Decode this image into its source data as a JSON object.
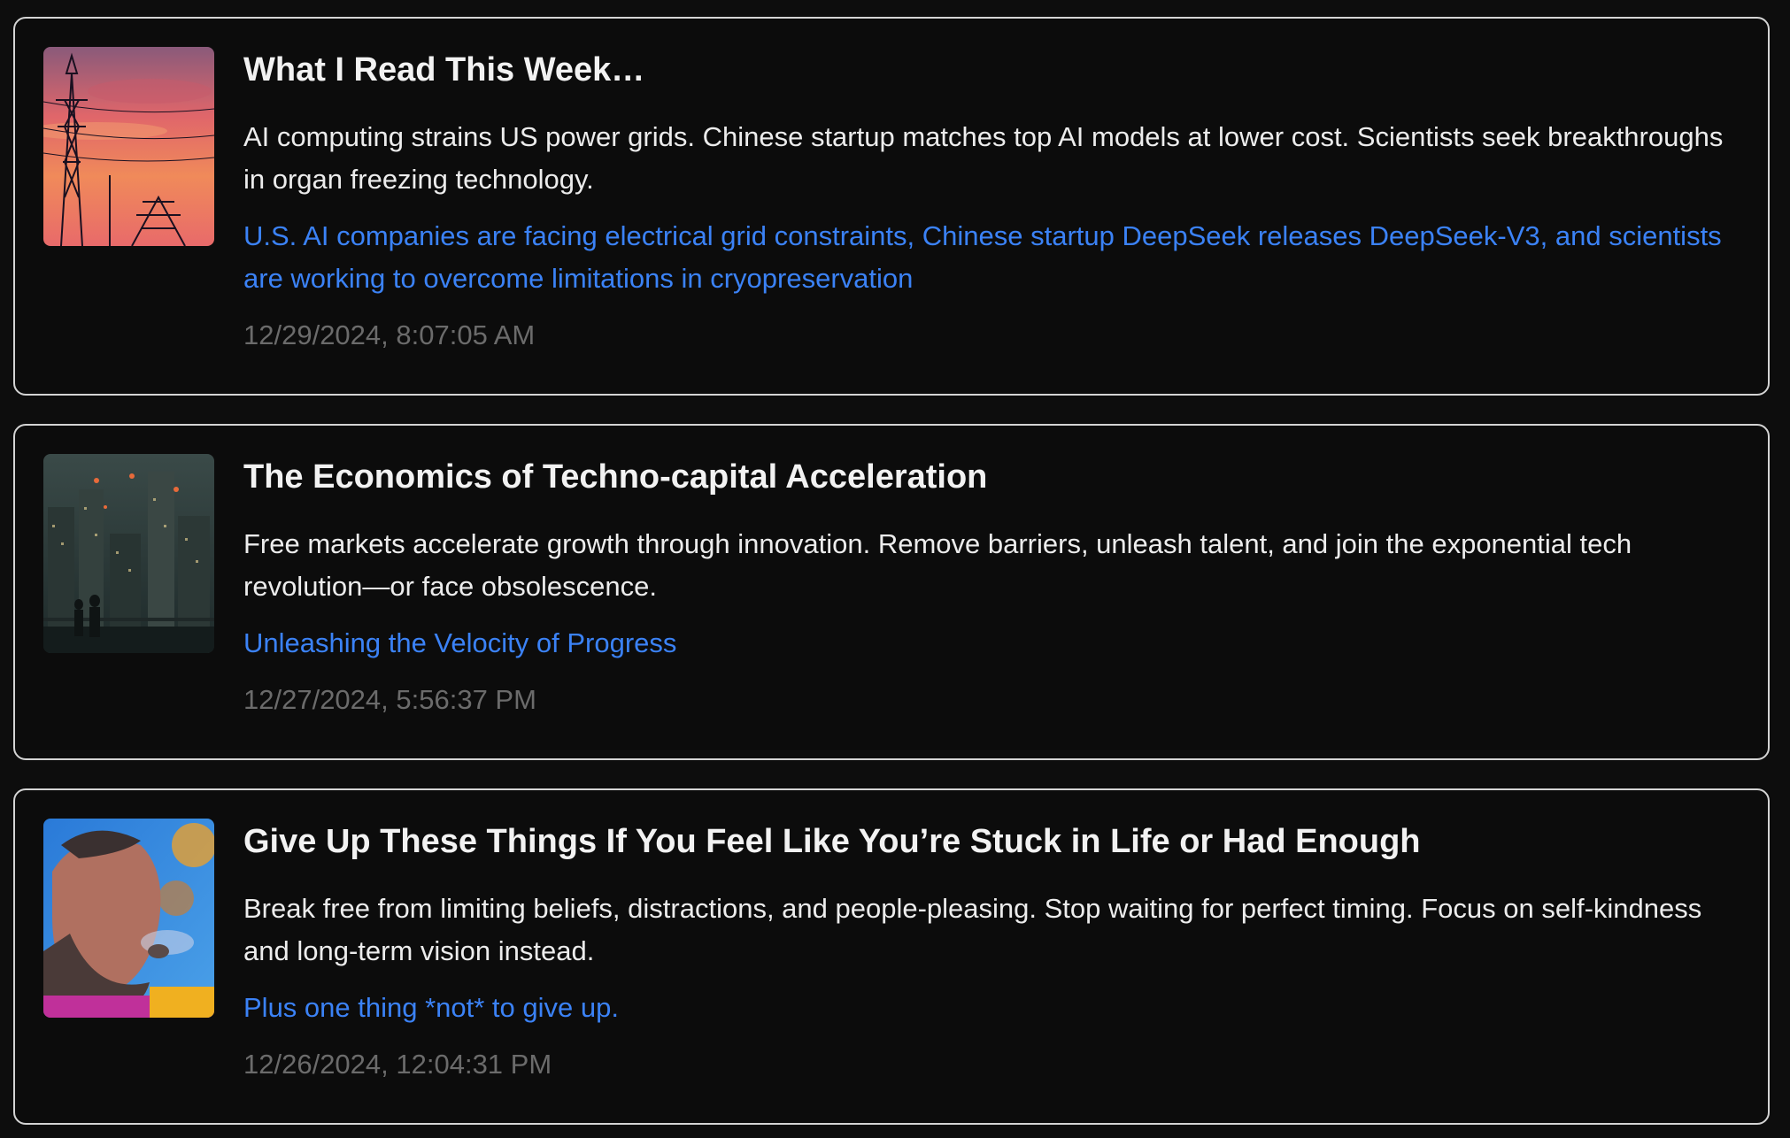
{
  "colors": {
    "background": "#0d0d0d",
    "card_border": "#d4d4d4",
    "title": "#f2f2f2",
    "link": "#3b82f6",
    "timestamp": "#6b6b6b"
  },
  "articles": [
    {
      "thumbnail": "power-lines-sunset-image",
      "title": "What I Read This Week…",
      "summary": "AI computing strains US power grids. Chinese startup matches top AI models at lower cost. Scientists seek breakthroughs in organ freezing technology.",
      "subtitle": "U.S. AI companies are facing electrical grid constraints, Chinese startup DeepSeek releases DeepSeek-V3, and scientists are working to overcome limitations in cryopreservation",
      "date": "12/29/2024, 8:07:05 AM"
    },
    {
      "thumbnail": "futuristic-city-image",
      "title": "The Economics of Techno-capital Acceleration",
      "summary": "Free markets accelerate growth through innovation. Remove barriers, unleash talent, and join the exponential tech revolution—or face obsolescence.",
      "subtitle": "Unleashing the Velocity of Progress",
      "date": "12/27/2024, 5:56:37 PM"
    },
    {
      "thumbnail": "bearded-man-smoking-image",
      "title": "Give Up These Things If You Feel Like You’re Stuck in Life or Had Enough",
      "summary": "Break free from limiting beliefs, distractions, and people-pleasing. Stop waiting for perfect timing. Focus on self-kindness and long-term vision instead.",
      "subtitle": "Plus one thing *not* to give up.",
      "date": "12/26/2024, 12:04:31 PM"
    }
  ]
}
